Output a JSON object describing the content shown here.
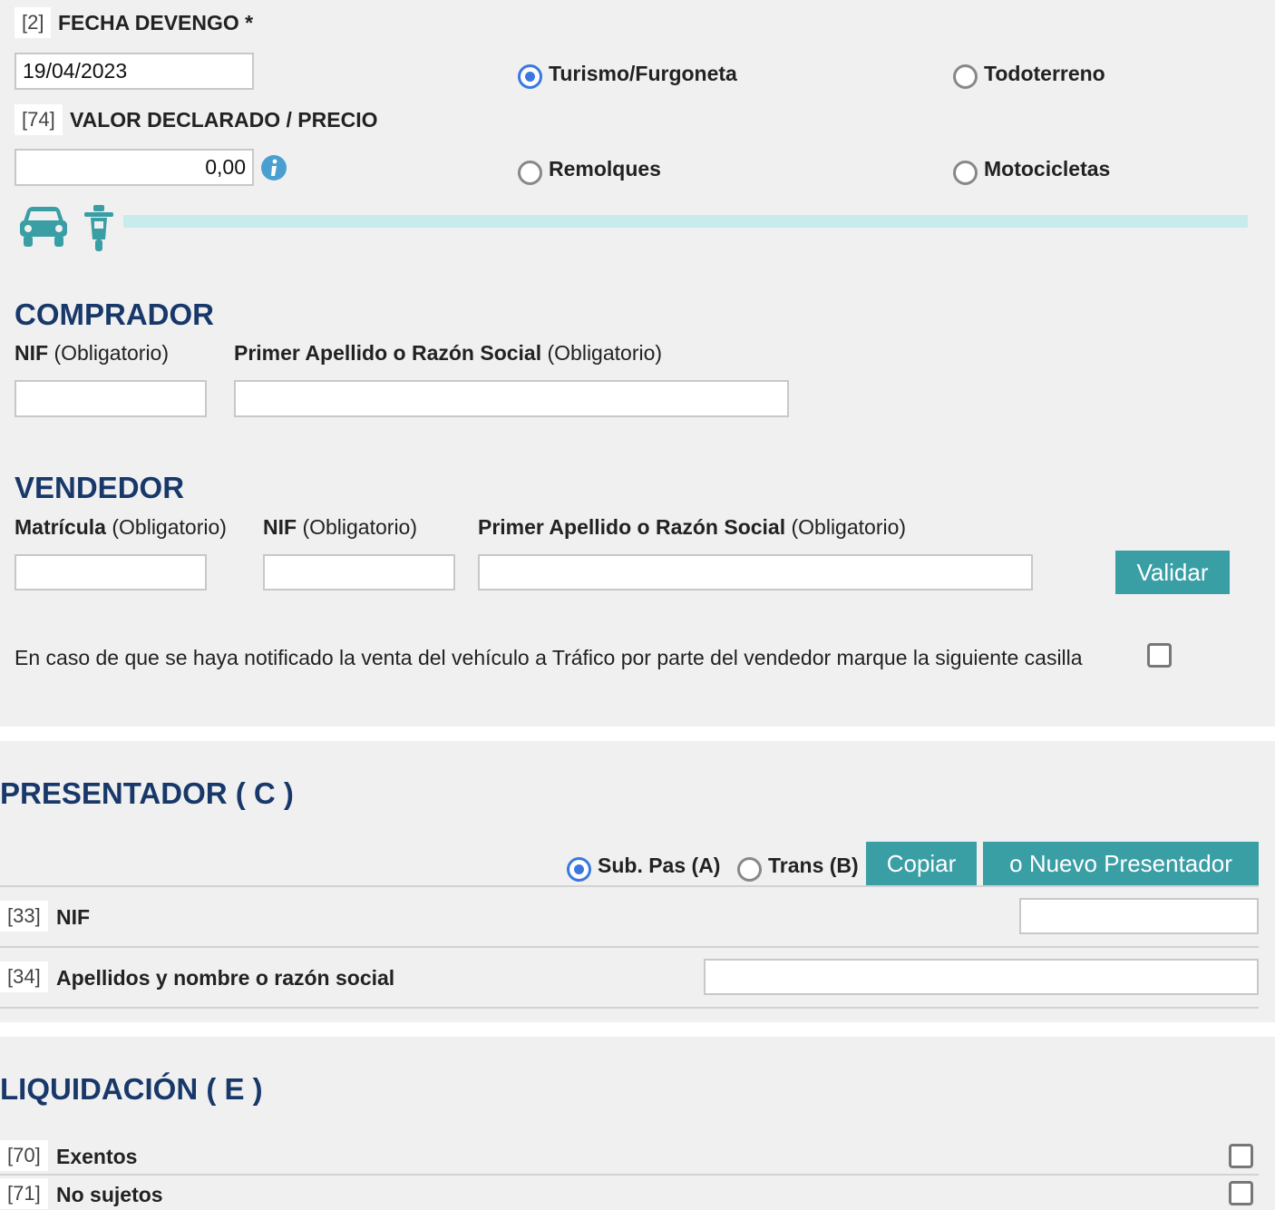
{
  "fecha": {
    "code": "[2]",
    "label": "FECHA DEVENGO *",
    "value": "19/04/2023"
  },
  "valor": {
    "code": "[74]",
    "label": "VALOR DECLARADO / PRECIO",
    "value": "0,00"
  },
  "vehicle_types": [
    {
      "label": "Turismo/Furgoneta",
      "selected": true
    },
    {
      "label": "Todoterreno",
      "selected": false
    },
    {
      "label": "Remolques",
      "selected": false
    },
    {
      "label": "Motocicletas",
      "selected": false
    }
  ],
  "comprador": {
    "title": "COMPRADOR",
    "nif_label": "NIF",
    "nif_hint": "(Obligatorio)",
    "nif_value": "",
    "apellido_label": "Primer Apellido o Razón Social",
    "apellido_hint": "(Obligatorio)",
    "apellido_value": ""
  },
  "vendedor": {
    "title": "VENDEDOR",
    "matricula_label": "Matrícula",
    "matricula_hint": "(Obligatorio)",
    "nif_label": "NIF",
    "nif_hint": "(Obligatorio)",
    "apellido_label": "Primer Apellido o Razón Social",
    "apellido_hint": "(Obligatorio)",
    "validar_label": "Validar",
    "notice_text": "En caso de que se haya notificado la venta del vehículo a Tráfico por parte del vendedor marque la siguiente casilla"
  },
  "presentador": {
    "title": "PRESENTADOR ( C )",
    "radio_a_label": "Sub. Pas (A)",
    "radio_a_selected": true,
    "radio_b_label": "Trans (B)",
    "radio_b_selected": false,
    "copiar_label": "Copiar",
    "nuevo_label": "o Nuevo Presentador",
    "nif_code": "[33]",
    "nif_label": "NIF",
    "nombre_code": "[34]",
    "nombre_label": "Apellidos y nombre o razón social"
  },
  "liquidacion": {
    "title": "LIQUIDACIÓN ( E )",
    "exentos_code": "[70]",
    "exentos_label": "Exentos",
    "nosujetos_code": "[71]",
    "nosujetos_label": "No sujetos"
  },
  "colors": {
    "accent": "#3a9ea5",
    "title": "#18386a",
    "radio": "#3a78e0",
    "progress": "#c8ecec"
  },
  "icons": [
    "info-icon",
    "car-icon",
    "motorcycle-icon"
  ]
}
